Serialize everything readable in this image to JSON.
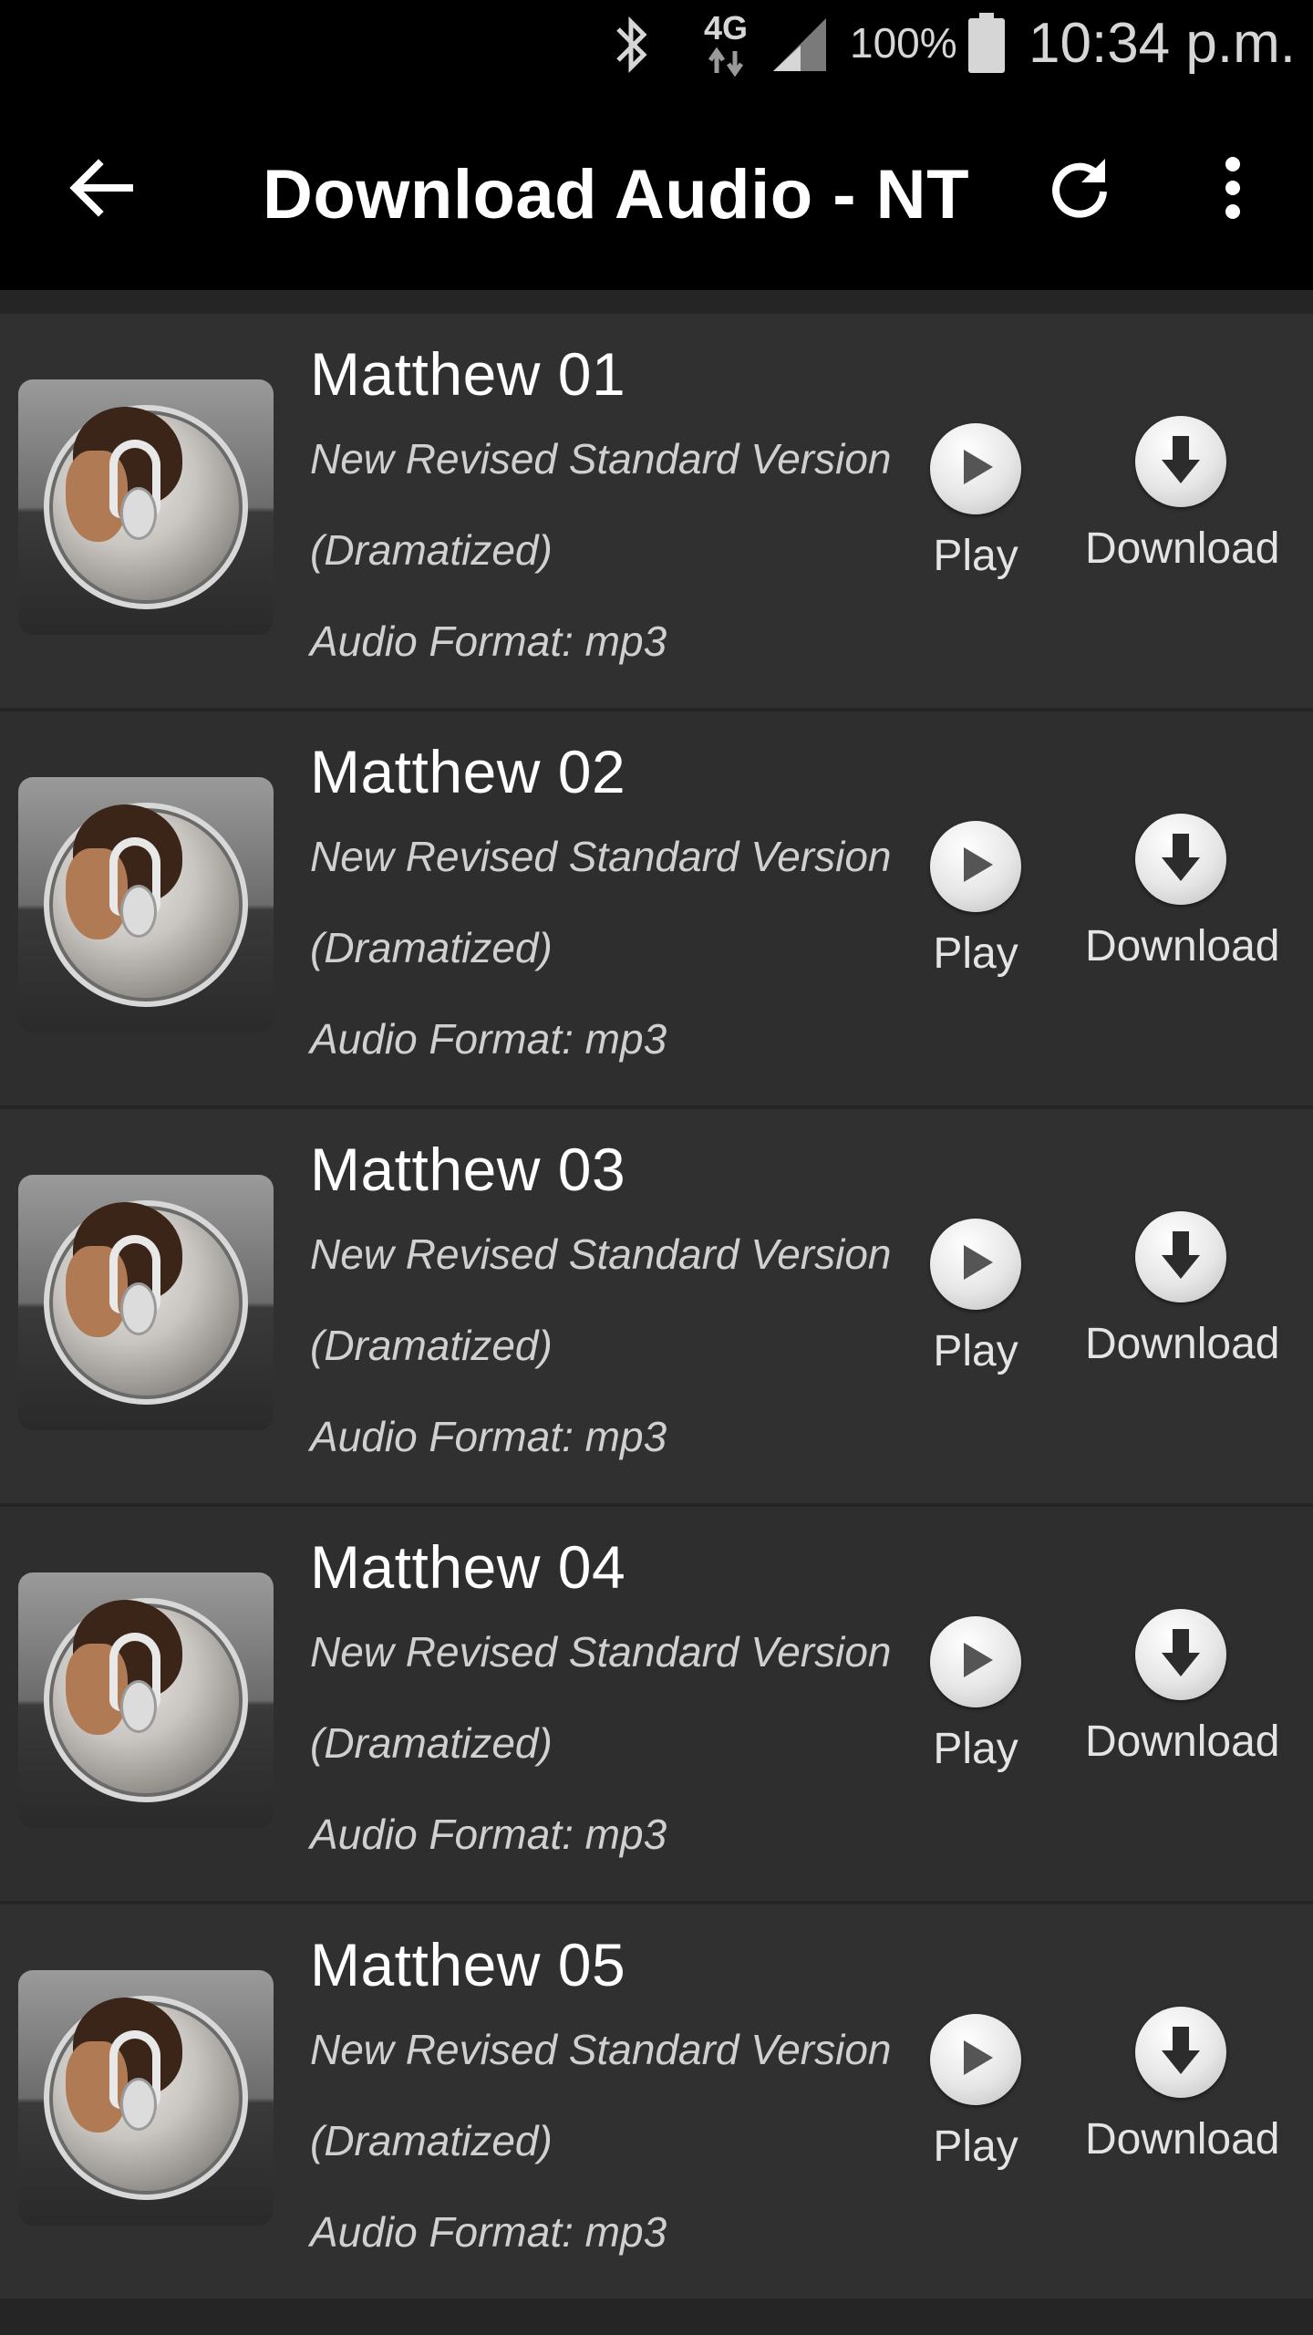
{
  "status_bar": {
    "network": "4G",
    "battery": "100%",
    "time": "10:34 p.m.",
    "icons": [
      "bluetooth-icon",
      "network-4g-icon",
      "signal-icon",
      "battery-icon"
    ]
  },
  "app_bar": {
    "title": "Download Audio - NT",
    "icons": [
      "back-arrow-icon",
      "refresh-icon",
      "more-vert-icon"
    ]
  },
  "items": [
    {
      "title": "Matthew 01",
      "version": "New Revised Standard Version",
      "edition": "(Dramatized)",
      "format": "Audio Format: mp3",
      "play_label": "Play",
      "download_label": "Download"
    },
    {
      "title": "Matthew 02",
      "version": "New Revised Standard Version",
      "edition": "(Dramatized)",
      "format": "Audio Format: mp3",
      "play_label": "Play",
      "download_label": "Download"
    },
    {
      "title": "Matthew 03",
      "version": "New Revised Standard Version",
      "edition": "(Dramatized)",
      "format": "Audio Format: mp3",
      "play_label": "Play",
      "download_label": "Download"
    },
    {
      "title": "Matthew 04",
      "version": "New Revised Standard Version",
      "edition": "(Dramatized)",
      "format": "Audio Format: mp3",
      "play_label": "Play",
      "download_label": "Download"
    },
    {
      "title": "Matthew 05",
      "version": "New Revised Standard Version",
      "edition": "(Dramatized)",
      "format": "Audio Format: mp3",
      "play_label": "Play",
      "download_label": "Download"
    }
  ],
  "colors": {
    "background": "#2b2b2b",
    "app_bar": "#000000",
    "text": "#ffffff",
    "subtext": "#d0d0d0"
  }
}
